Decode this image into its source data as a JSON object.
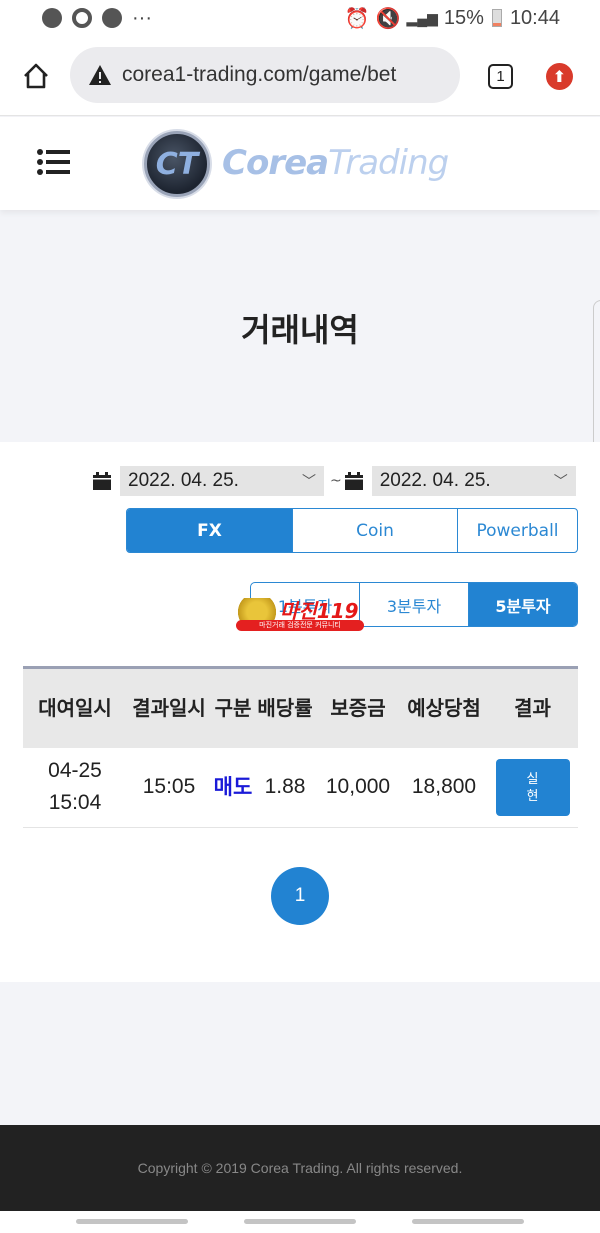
{
  "status_bar": {
    "battery": "15%",
    "time": "10:44"
  },
  "browser": {
    "url": "corea1-trading.com/game/bet",
    "tab_count": "1"
  },
  "header": {
    "logo_badge": "CT",
    "logo_main": "Corea",
    "logo_sub": "Trading"
  },
  "page": {
    "title": "거래내역"
  },
  "filters": {
    "date_from": "2022. 04. 25.",
    "date_to": "2022. 04. 25.",
    "separator": "~",
    "categories": [
      {
        "label": "FX",
        "active": true
      },
      {
        "label": "Coin",
        "active": false
      },
      {
        "label": "Powerball",
        "active": false
      }
    ],
    "intervals": [
      {
        "label": "1분투자",
        "active": false
      },
      {
        "label": "3분투자",
        "active": false
      },
      {
        "label": "5분투자",
        "active": true
      }
    ]
  },
  "overlay_badge": {
    "text": "마진119",
    "subtext": "마진거래 검증전문 커뮤니티"
  },
  "table": {
    "headers": [
      "대여일시",
      "결과일시",
      "구분",
      "배당률",
      "보증금",
      "예상당첨",
      "결과"
    ],
    "rows": [
      {
        "start": "04-25 15:04",
        "result_time": "15:05",
        "kind": "매도",
        "rate": "1.88",
        "deposit": "10,000",
        "expected": "18,800",
        "result": "실현"
      }
    ]
  },
  "pagination": {
    "current": "1"
  },
  "footer": {
    "copyright": "Copyright © 2019 Corea Trading. All rights reserved."
  },
  "colors": {
    "accent": "#2283d2",
    "sell": "#1a1ad8",
    "footer_bg": "#222222"
  }
}
